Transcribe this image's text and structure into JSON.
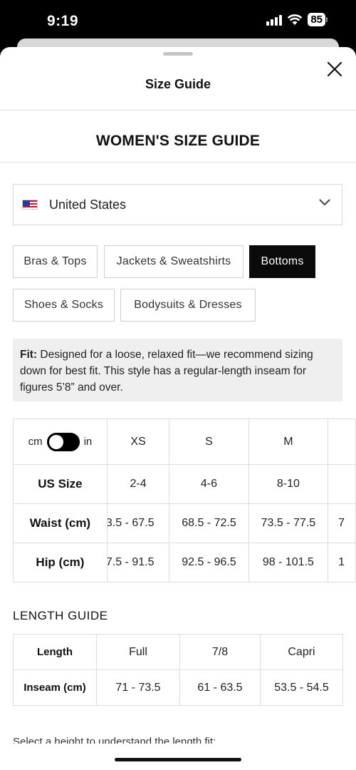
{
  "status_bar": {
    "time": "9:19",
    "battery": "85"
  },
  "sheet": {
    "title": "Size Guide",
    "close_icon": "close-icon"
  },
  "page": {
    "heading": "WOMEN'S SIZE GUIDE"
  },
  "country": {
    "flag_icon": "us-flag-icon",
    "selected": "United States"
  },
  "categories": [
    {
      "label": "Bras & Tops",
      "active": false
    },
    {
      "label": "Jackets & Sweatshirts",
      "active": false
    },
    {
      "label": "Bottoms",
      "active": true
    },
    {
      "label": "Shoes & Socks",
      "active": false
    },
    {
      "label": "Bodysuits & Dresses",
      "active": false
    }
  ],
  "fit": {
    "label": "Fit:",
    "text": "Designed for a loose, relaxed fit—we recommend sizing down for best fit. This style has a regular-length inseam for figures 5’8” and over."
  },
  "size_table": {
    "unit_left": "cm",
    "unit_right": "in",
    "unit_selected": "cm",
    "sizes": [
      "XS",
      "S",
      "M"
    ],
    "rows": [
      {
        "label": "US Size",
        "values": [
          "2-4",
          "4-6",
          "8-10",
          ""
        ]
      },
      {
        "label": "Waist (cm)",
        "values": [
          "3.5 - 67.5",
          "68.5 - 72.5",
          "73.5 - 77.5",
          "7"
        ]
      },
      {
        "label": "Hip (cm)",
        "values": [
          "7.5 - 91.5",
          "92.5 - 96.5",
          "98 - 101.5",
          "1"
        ]
      }
    ]
  },
  "length_guide": {
    "title": "LENGTH GUIDE",
    "header": [
      "Length",
      "Full",
      "7/8",
      "Capri"
    ],
    "row": [
      "Inseam (cm)",
      "71 - 73.5",
      "61 - 63.5",
      "53.5 - 54.5"
    ]
  },
  "helper_text": "Select a height to understand the length fit:",
  "colors": {
    "accent": "#0a0a0a",
    "border": "#dcdcdc",
    "fit_bg": "#efefef"
  }
}
